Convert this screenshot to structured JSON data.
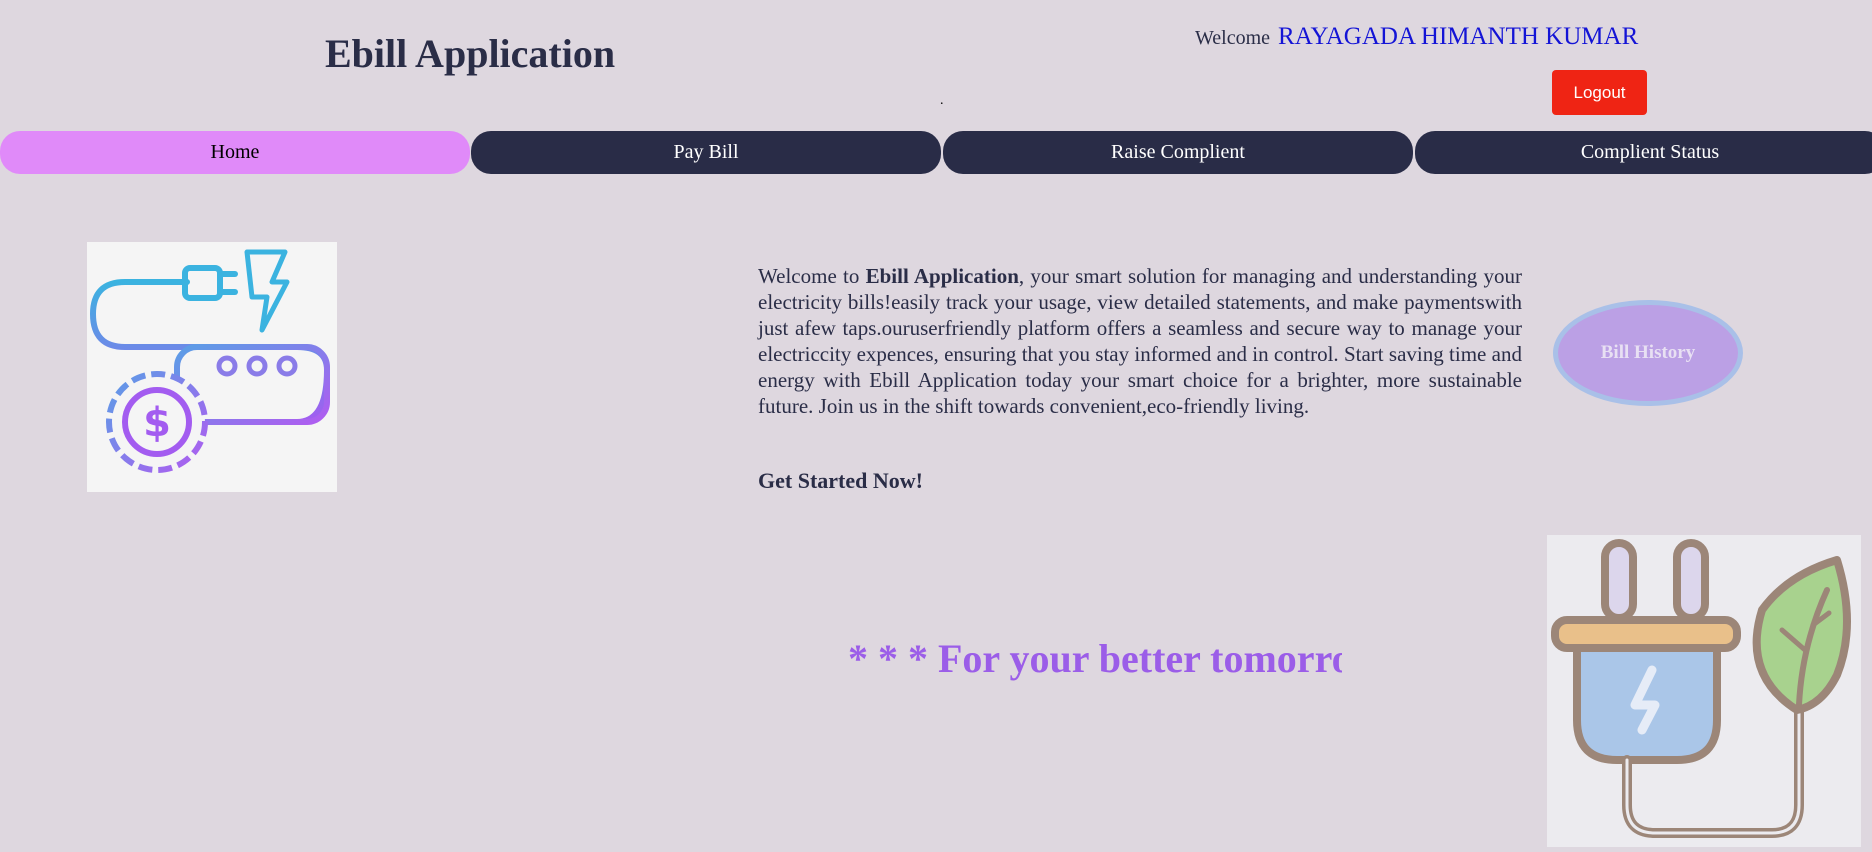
{
  "header": {
    "app_title": "Ebill Application",
    "welcome_label": "Welcome",
    "user_name": "RAYAGADA HIMANTH KUMAR",
    "separator": ".",
    "logout_label": "Logout"
  },
  "nav": {
    "tabs": [
      {
        "label": "Home",
        "active": true
      },
      {
        "label": "Pay Bill",
        "active": false
      },
      {
        "label": "Raise Complient",
        "active": false
      },
      {
        "label": "Complient Status",
        "active": false
      }
    ]
  },
  "main": {
    "intro_prefix": "Welcome to ",
    "intro_app_name": "Ebill Application",
    "intro_body": ", your smart solution for managing and understanding your electricity bills!easily track your usage, view detailed statements, and make paymentswith just afew taps.ouruserfriendly platform offers a seamless and secure way to manage your electriccity expences, ensuring that you stay informed and in control. Start saving time and energy with Ebill Application today your smart choice for a brighter, more sustainable future. Join us in the shift towards convenient,eco-friendly living.",
    "get_started": "Get Started Now!",
    "bill_history_label": "Bill History",
    "marquee_text": "* * * For your better tomorro"
  },
  "images": {
    "hero_icon": "plug-gear-dollar-icon",
    "footer_icon": "plug-leaf-icon"
  },
  "colors": {
    "background": "#ded7df",
    "nav_dark": "#292c47",
    "nav_active": "#e08af9",
    "logout": "#ef2414",
    "user_name": "#1414d6",
    "marquee": "#9b5de8",
    "bill_history_fill": "#bba0e5"
  }
}
